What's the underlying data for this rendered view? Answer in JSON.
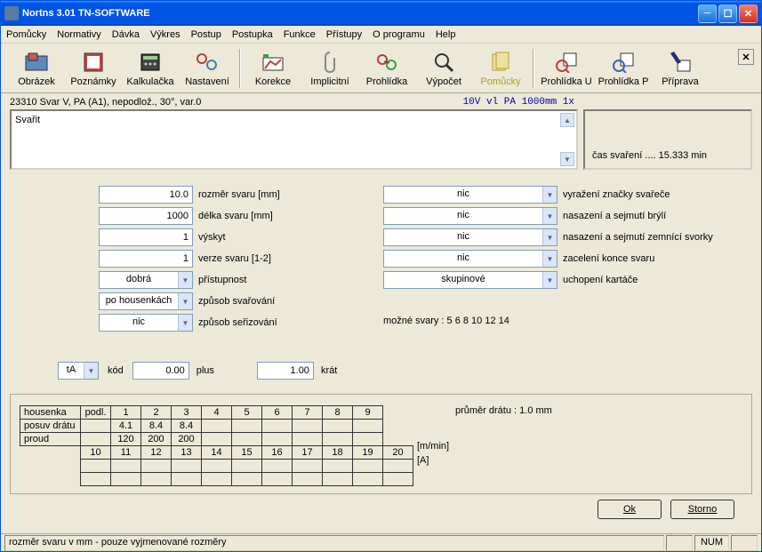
{
  "title": "Nortns 3.01 TN-SOFTWARE",
  "menu": [
    "Pomůcky",
    "Normativy",
    "Dávka",
    "Výkres",
    "Postup",
    "Postupka",
    "Funkce",
    "Přístupy",
    "O programu",
    "Help"
  ],
  "tools": [
    "Obrázek",
    "Poznámky",
    "Kalkulačka",
    "Nastavení",
    "Korekce",
    "Implicitní",
    "Prohlídka",
    "Výpočet",
    "Pomůcky",
    "Prohlídka U",
    "Prohlídka P",
    "Příprava"
  ],
  "header_left": "23310 Svar V, PA (A1), nepodlož., 30°, var.0",
  "header_right": "10V vl PA 1000mm 1x",
  "textarea": "Svařit",
  "time_label": "čas svaření .... 15.333 min",
  "left_fields": {
    "rozmer": {
      "val": "10.0",
      "lbl": "rozměr svaru [mm]"
    },
    "delka": {
      "val": "1000",
      "lbl": "délka svaru [mm]"
    },
    "vyskyt": {
      "val": "1",
      "lbl": "výskyt"
    },
    "verze": {
      "val": "1",
      "lbl": "verze svaru [1-2]"
    },
    "prist": {
      "val": "dobrá",
      "lbl": "přístupnost"
    },
    "zpusob_sv": {
      "val": "po housenkách",
      "lbl": "způsob svařování"
    },
    "zpusob_ser": {
      "val": "nic",
      "lbl": "způsob seřizování"
    }
  },
  "right_fields": [
    {
      "val": "nic",
      "lbl": "vyražení značky svařeče"
    },
    {
      "val": "nic",
      "lbl": "nasazení a sejmutí brýlí"
    },
    {
      "val": "nic",
      "lbl": "nasazení a sejmutí zemnící svorky"
    },
    {
      "val": "nic",
      "lbl": "zacelení konce svaru"
    },
    {
      "val": "skupinové",
      "lbl": "uchopení kartáče"
    }
  ],
  "kod": {
    "sel": "tA",
    "lbl": "kód",
    "plus_val": "0.00",
    "plus": "plus",
    "krat_val": "1.00",
    "krat": "krát"
  },
  "possible": "možné svary : 5 6 8 10 12 14",
  "table": {
    "row1_hdr": "housenka",
    "row1_sub": "podl.",
    "cols1": [
      "1",
      "2",
      "3",
      "4",
      "5",
      "6",
      "7",
      "8",
      "9"
    ],
    "row2_hdr": "posuv drátu",
    "row2": [
      "4.1",
      "8.4",
      "8.4",
      "",
      "",
      "",
      "",
      "",
      ""
    ],
    "row3_hdr": "proud",
    "row3": [
      "120",
      "200",
      "200",
      "",
      "",
      "",
      "",
      "",
      ""
    ],
    "cols2": [
      "10",
      "11",
      "12",
      "13",
      "14",
      "15",
      "16",
      "17",
      "18",
      "19",
      "20"
    ],
    "unit1": "[m/min]",
    "unit2": "[A]"
  },
  "diameter": "průměr drátu : 1.0 mm",
  "ok": "Ok",
  "storno": "Storno",
  "status": "rozměr svaru v mm - pouze vyjmenované rozměry",
  "num": "NUM"
}
